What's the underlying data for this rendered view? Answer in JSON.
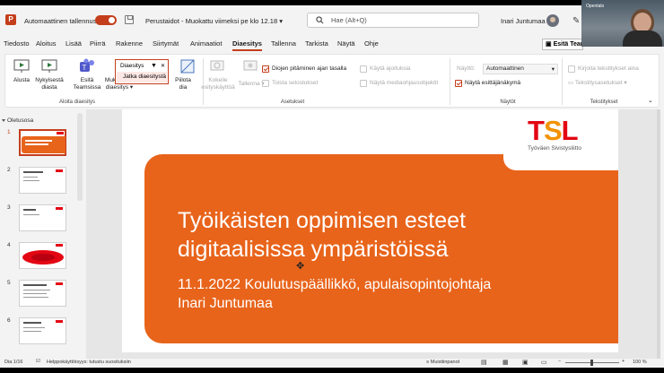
{
  "titlebar": {
    "autosave": "Automaattinen tallennus",
    "doc_title": "Perustaidot - Muokattu viimeksi pe klo 12.18",
    "search_placeholder": "Hae (Alt+Q)",
    "user": "Inari Juntumaa"
  },
  "tabs": [
    "Tiedosto",
    "Aloitus",
    "Lisää",
    "Piirrä",
    "Rakenne",
    "Siirtymät",
    "Animaatiot",
    "Diaesitys",
    "Tallenna",
    "Tarkista",
    "Näytä",
    "Ohje"
  ],
  "present_button": "Esitä Teamsissa",
  "ribbon": {
    "alusta": "Alusta",
    "nykyisesta_1": "Nykyisestä",
    "nykyisesta_2": "diasta",
    "teams_1": "Esitä",
    "teams_2": "Teamsissa",
    "muk_1": "Mukautettu",
    "muk_2": "diaesitys",
    "popup_1": "Diaesitys",
    "popup_2": "Jatka diaesitystä",
    "piilota_1": "Piilota",
    "piilota_2": "dia",
    "kokeile_1": "Kokeile",
    "kokeile_2": "esityskäyttöä",
    "tallenna": "Tallenna",
    "diojen": "Diojen pitäminen ajan tasalla",
    "toista": "Toista selostukset",
    "kayta": "Käytä ajoituksia",
    "nayta_media": "Näytä mediaohjausobjektit",
    "nayttö": "Näyttö:",
    "automaattinen": "Automaattinen",
    "esittaja": "Näytä esittäjänäkymä",
    "kirjoita": "Kirjoita tekstitykset aina",
    "tekstitysasetukset": "Tekstitysasetukset",
    "group_aloita": "Aloita diaesitys",
    "group_asetukset": "Asetukset",
    "group_naytot": "Näytöt",
    "group_tekstit": "Tekstitykset"
  },
  "pane": {
    "section": "Oletusosa",
    "slide_numbers": [
      "1",
      "2",
      "3",
      "4",
      "5",
      "6"
    ]
  },
  "slide": {
    "logo_t": "T",
    "logo_s": "S",
    "logo_l": "L",
    "logo_sub": "Työväen Sivistysliitto",
    "title_1": "Työikäisten oppimisen esteet",
    "title_2": "digitaalisissa ympäristöissä",
    "sub_1": "11.1.2022 Koulutuspäällikkö, apulaisopintojohtaja",
    "sub_2": "Inari Juntumaa"
  },
  "status": {
    "slide": "Dia 1/16",
    "access": "Helppokäyttöisyys: tutustu suosituksiin",
    "notes": "Muistiinpanot",
    "zoom": "100 %"
  },
  "webcam_label": "Opentalo"
}
